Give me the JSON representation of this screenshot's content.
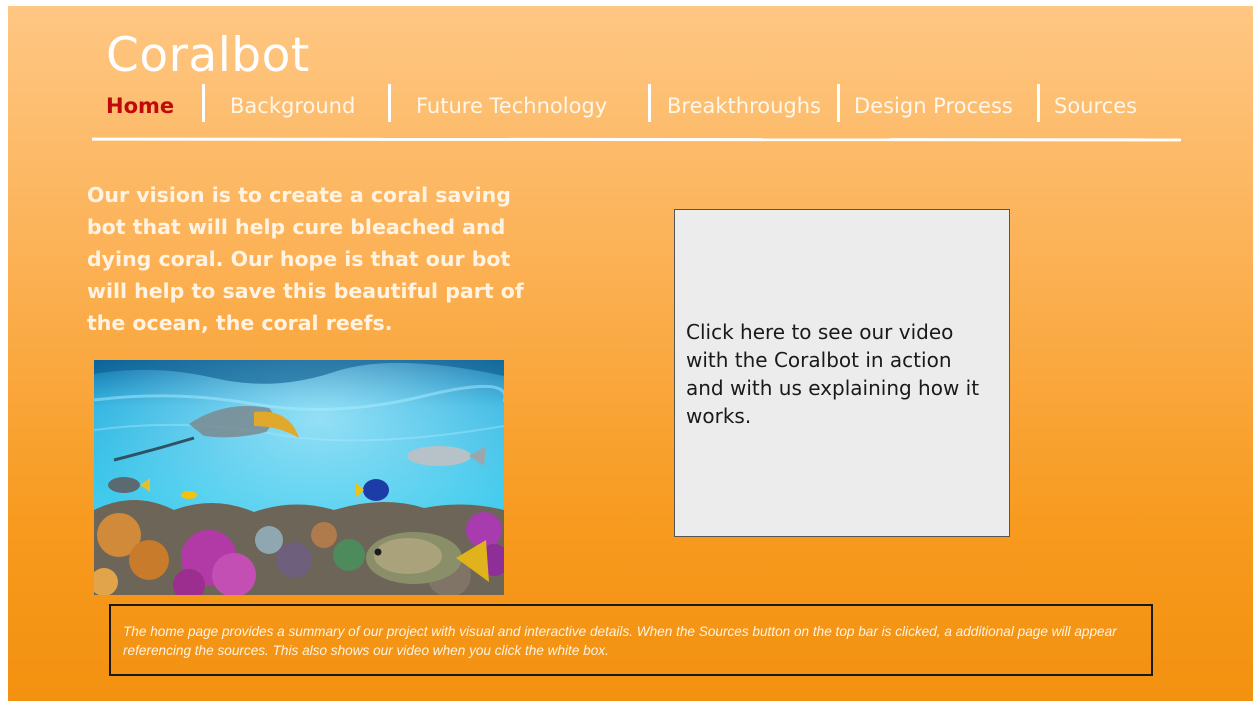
{
  "site": {
    "brand": "Coralbot"
  },
  "nav": {
    "items": [
      {
        "label": "Home",
        "active": true
      },
      {
        "label": "Background",
        "active": false
      },
      {
        "label": "Future Technology",
        "active": false
      },
      {
        "label": "Breakthroughs",
        "active": false
      },
      {
        "label": "Design Process",
        "active": false
      },
      {
        "label": "Sources",
        "active": false
      }
    ]
  },
  "main": {
    "vision": "Our vision is to create a coral saving bot that will help cure bleached and dying coral. Our hope is that our bot will help to save this beautiful part of the ocean, the coral reefs.",
    "video_box_text": "Click here to see our video with the Coralbot in action and with us explaining how it works."
  },
  "footer": {
    "note": "The home page provides a summary of our project with visual and interactive details. When the Sources button on the top bar is clicked, a additional page will appear referencing the sources. This also shows our video when you click the white box."
  },
  "colors": {
    "active_nav": "#c0090b",
    "background_top": "#fec783",
    "background_bottom": "#f39110",
    "video_box": "#ececec"
  }
}
